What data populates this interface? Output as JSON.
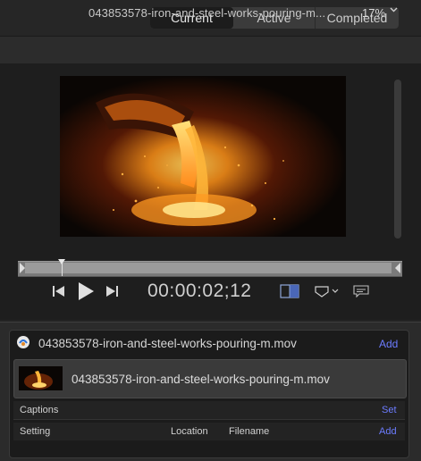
{
  "tabs": [
    {
      "label": "Current",
      "selected": true
    },
    {
      "label": "Active",
      "selected": false
    },
    {
      "label": "Completed",
      "selected": false
    }
  ],
  "viewer": {
    "filename": "043853578-iron-and-steel-works-pouring-m...",
    "zoom": "17%",
    "timecode": "00:00:02;12"
  },
  "job": {
    "title": "043853578-iron-and-steel-works-pouring-m.mov",
    "add_label": "Add",
    "item": {
      "name": "043853578-iron-and-steel-works-pouring-m.mov"
    },
    "captions": {
      "label": "Captions",
      "action": "Set"
    },
    "table_headers": {
      "setting": "Setting",
      "location": "Location",
      "filename": "Filename",
      "action": "Add"
    }
  },
  "colors": {
    "accent": "#6c7cff",
    "background": "#232323"
  },
  "icons": [
    "skip-back-icon",
    "play-icon",
    "skip-forward-icon",
    "view-toggle-icon",
    "overlay-menu-icon",
    "caption-icon",
    "compressor-icon",
    "chevron-down-icon"
  ]
}
